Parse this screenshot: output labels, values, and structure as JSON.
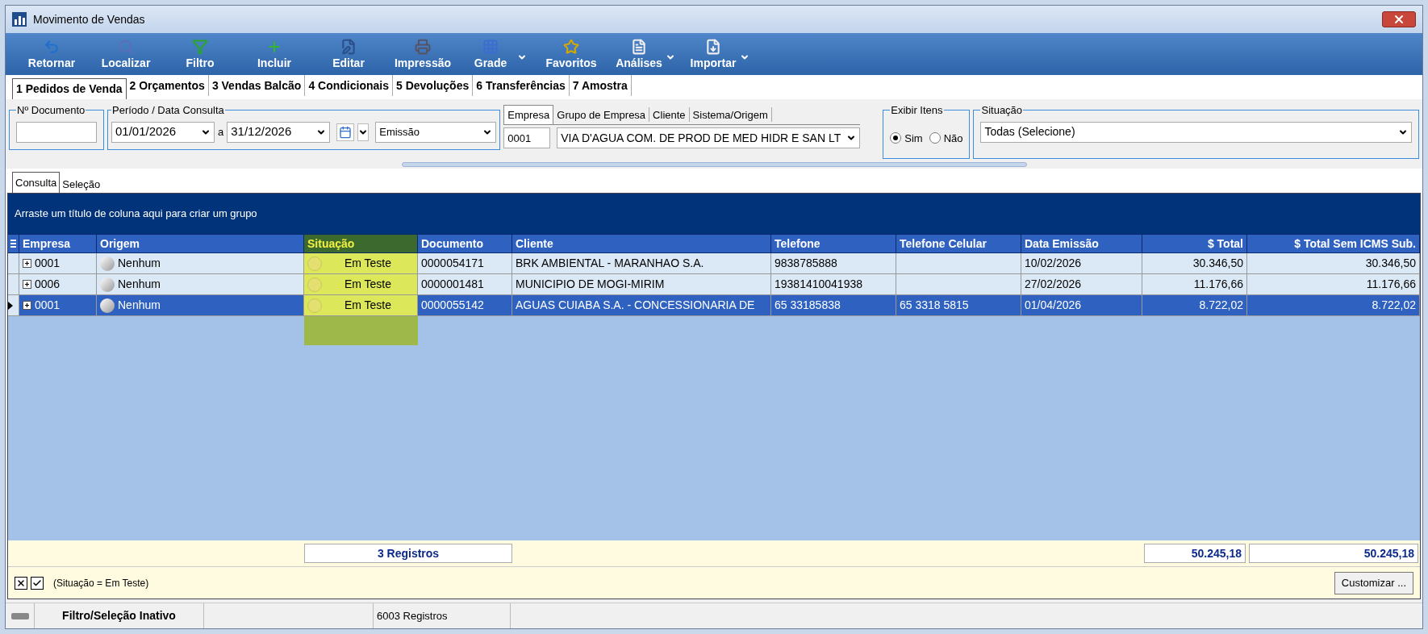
{
  "window": {
    "title": "Movimento de Vendas"
  },
  "toolbar": [
    {
      "label": "Retornar",
      "dropdown": false
    },
    {
      "label": "Localizar",
      "dropdown": false
    },
    {
      "label": "Filtro",
      "dropdown": false
    },
    {
      "label": "Incluir",
      "dropdown": false
    },
    {
      "label": "Editar",
      "dropdown": false
    },
    {
      "label": "Impressão",
      "dropdown": false
    },
    {
      "label": "Grade",
      "dropdown": true
    },
    {
      "label": "Favoritos",
      "dropdown": false
    },
    {
      "label": "Análises",
      "dropdown": true
    },
    {
      "label": "Importar",
      "dropdown": true
    }
  ],
  "tabs": [
    {
      "label": "1 Pedidos de Venda",
      "selected": true
    },
    {
      "label": "2 Orçamentos",
      "selected": false
    },
    {
      "label": "3 Vendas Balcão",
      "selected": false
    },
    {
      "label": "4 Condicionais",
      "selected": false
    },
    {
      "label": "5 Devoluções",
      "selected": false
    },
    {
      "label": "6 Transferências",
      "selected": false
    },
    {
      "label": "7 Amostra",
      "selected": false
    }
  ],
  "filters": {
    "documento": {
      "label": "Nº Documento"
    },
    "periodo": {
      "label": "Período / Data Consulta",
      "from": "01/01/2026",
      "separator": "a",
      "to": "31/12/2026",
      "type": "Emissão"
    },
    "empresa_tabs": [
      {
        "label": "Empresa",
        "selected": true
      },
      {
        "label": "Grupo de Empresa",
        "selected": false
      },
      {
        "label": "Cliente",
        "selected": false
      },
      {
        "label": "Sistema/Origem",
        "selected": false
      }
    ],
    "empresa": {
      "code": "0001",
      "name": "VIA D'AGUA COM. DE PROD DE MED HIDR E SAN LT"
    },
    "exibir_itens": {
      "label": "Exibir Itens",
      "options": [
        {
          "label": "Sim",
          "selected": true
        },
        {
          "label": "Não",
          "selected": false
        }
      ]
    },
    "situacao": {
      "label": "Situação",
      "value": "Todas (Selecione)"
    }
  },
  "sub_tabs": [
    {
      "label": "Consulta",
      "selected": true
    },
    {
      "label": "Seleção",
      "selected": false
    }
  ],
  "group_panel": "Arraste um título de coluna aqui para criar um grupo",
  "table": {
    "columns": [
      "Empresa",
      "Origem",
      "Situação",
      "Documento",
      "Cliente",
      "Telefone",
      "Telefone Celular",
      "Data Emissão",
      "$ Total",
      "$ Total Sem ICMS Sub."
    ],
    "rows": [
      {
        "selected": false,
        "cells": [
          "0001",
          "Nenhum",
          "Em Teste",
          "0000054171",
          "BRK AMBIENTAL - MARANHAO S.A.",
          "9838785888",
          "",
          "10/02/2026",
          "30.346,50",
          "30.346,50"
        ]
      },
      {
        "selected": false,
        "cells": [
          "0006",
          "Nenhum",
          "Em Teste",
          "0000001481",
          "MUNICIPIO DE MOGI-MIRIM",
          "19381410041938",
          "",
          "27/02/2026",
          "11.176,66",
          "11.176,66"
        ]
      },
      {
        "selected": true,
        "cells": [
          "0001",
          "Nenhum",
          "Em Teste",
          "0000055142",
          "AGUAS CUIABA S.A. - CONCESSIONARIA DE",
          "65 33185838",
          "65  3318 5815",
          "01/04/2026",
          "8.722,02",
          "8.722,02"
        ]
      }
    ],
    "footer": {
      "count": "3 Registros",
      "total": "50.245,18",
      "total_sem_icms": "50.245,18"
    }
  },
  "filter_bar": {
    "active": true,
    "enabled": true,
    "text": "(Situação = Em Teste)",
    "button": "Customizar ..."
  },
  "status_bar": [
    "Filtro/Seleção Inativo",
    "6003 Registros"
  ]
}
